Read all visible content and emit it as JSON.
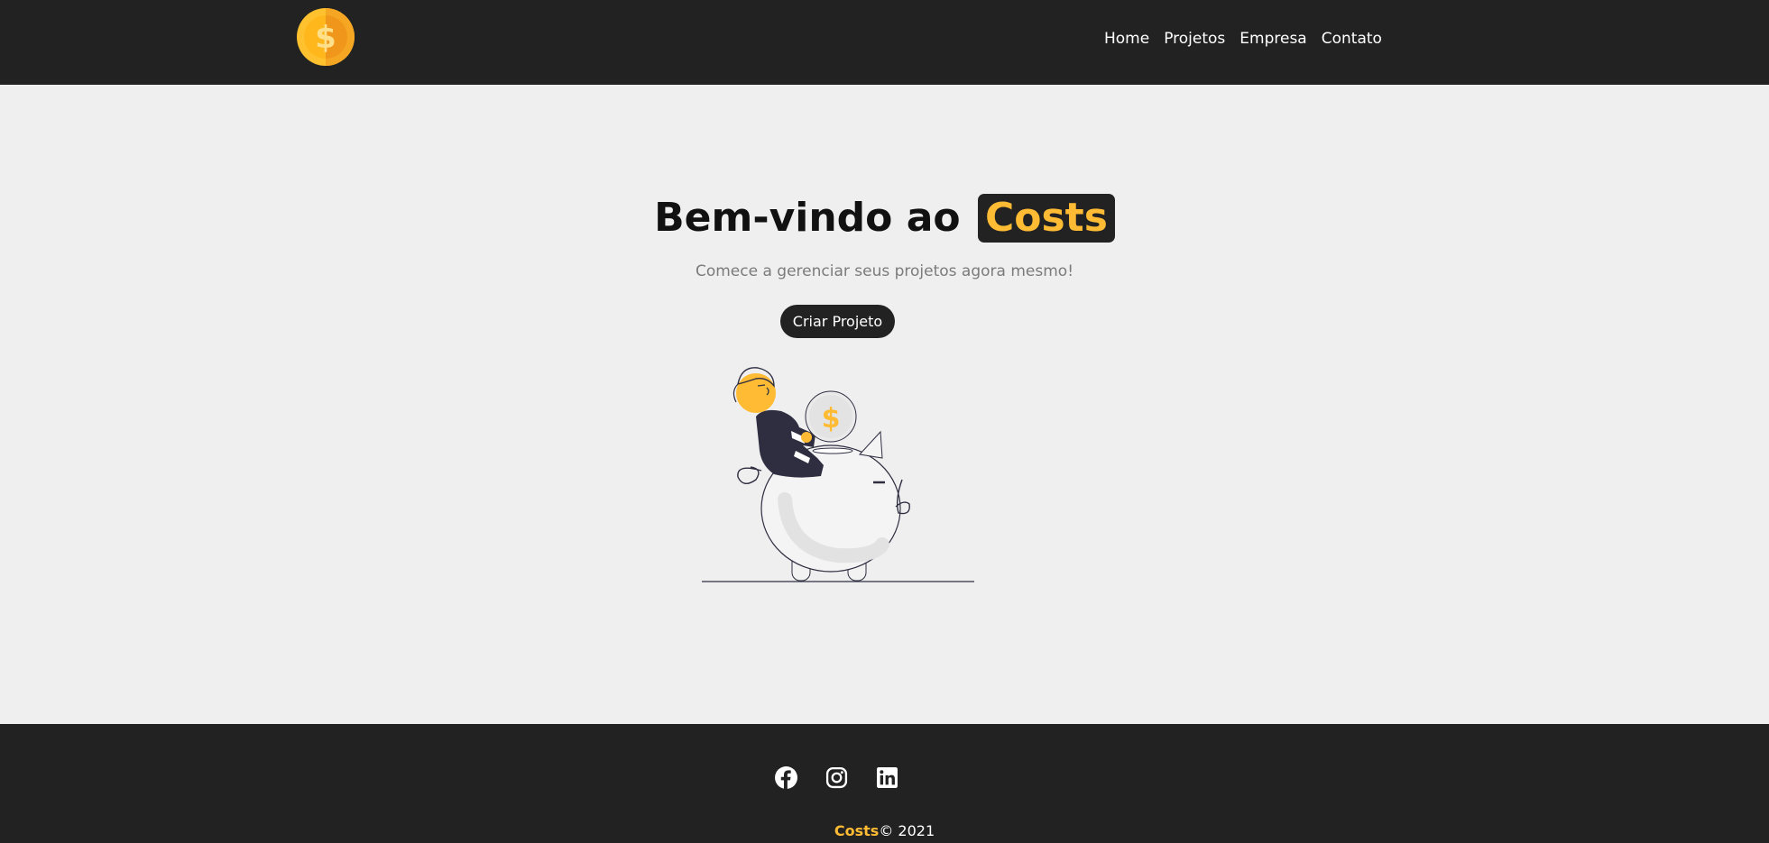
{
  "navbar": {
    "logo_icon": "coin-dollar-icon",
    "links": [
      {
        "label": "Home"
      },
      {
        "label": "Projetos"
      },
      {
        "label": "Empresa"
      },
      {
        "label": "Contato"
      }
    ]
  },
  "home": {
    "title_prefix": "Bem-vindo ao",
    "title_brand": "Costs",
    "subtitle": "Comece a gerenciar seus projetos agora mesmo!",
    "cta_label": "Criar Projeto",
    "illustration": "piggy-bank-savings-illustration"
  },
  "footer": {
    "social_icons": [
      "facebook-icon",
      "instagram-icon",
      "linkedin-icon"
    ],
    "brand": "Costs",
    "copyright": "© 2021"
  },
  "colors": {
    "dark": "#222222",
    "accent": "#ffbb33",
    "background": "#efefef",
    "muted_text": "#7b7b7b"
  }
}
